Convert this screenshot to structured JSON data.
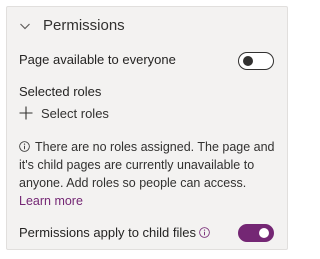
{
  "section": {
    "title": "Permissions",
    "chevron_icon": "chevron-down-icon"
  },
  "page_available": {
    "label": "Page available to everyone",
    "toggle_state": "off"
  },
  "selected_roles": {
    "heading": "Selected roles",
    "add_label": "Select roles",
    "add_icon": "plus-icon"
  },
  "info": {
    "icon": "info-icon",
    "message": "There are no roles assigned. The page and it's child pages are currently unavailable to anyone. Add roles so people can access.",
    "link_text": "Learn more"
  },
  "child_files": {
    "label": "Permissions apply to child files",
    "info_icon": "info-icon",
    "toggle_state": "on"
  },
  "colors": {
    "accent": "#742774",
    "panel_bg": "#f3f2f1",
    "text": "#323130"
  }
}
